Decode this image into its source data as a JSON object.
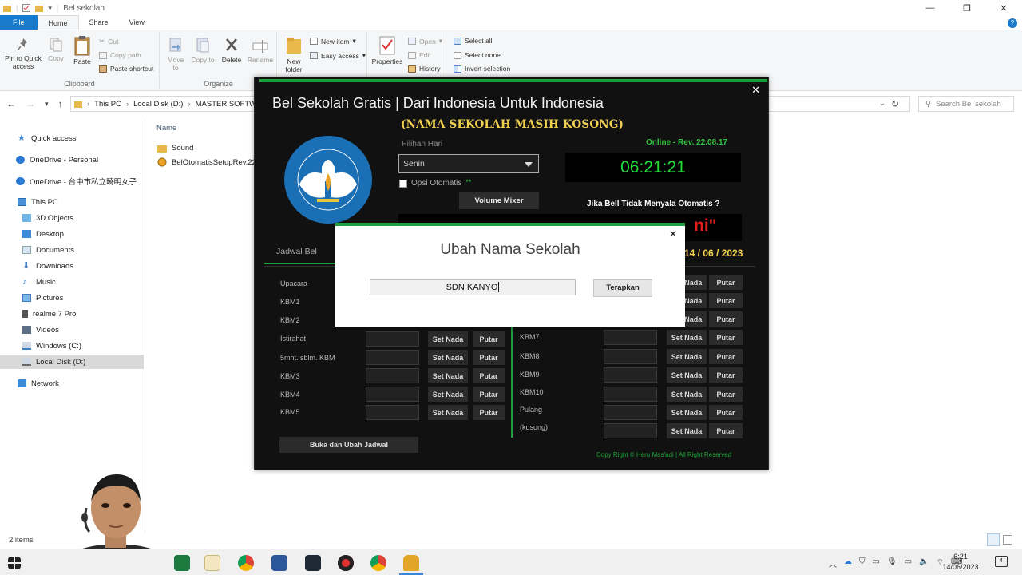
{
  "explorer": {
    "title": "Bel sekolah",
    "ribbon_tabs": [
      "File",
      "Home",
      "Share",
      "View"
    ],
    "clipboard": {
      "group_label": "Clipboard",
      "pin_label": "Pin to Quick access",
      "copy_label": "Copy",
      "paste_label": "Paste",
      "cut_label": "Cut",
      "copy_path_label": "Copy path",
      "paste_shortcut_label": "Paste shortcut"
    },
    "organize": {
      "group_label": "Organize",
      "move_to_label": "Move to",
      "copy_to_label": "Copy to",
      "delete_label": "Delete",
      "rename_label": "Rename"
    },
    "new": {
      "new_folder_label": "New folder",
      "new_item_label": "New item",
      "easy_access_label": "Easy access"
    },
    "open": {
      "properties_label": "Properties",
      "open_label": "Open",
      "edit_label": "Edit",
      "history_label": "History"
    },
    "select": {
      "select_all_label": "Select all",
      "select_none_label": "Select none",
      "invert_label": "Invert selection"
    },
    "address": {
      "crumbs": [
        "This PC",
        "Local Disk (D:)",
        "MASTER SOFTW"
      ],
      "search_placeholder": "Search Bel sekolah"
    },
    "nav_items": [
      {
        "label": "Quick access",
        "icon": "star-icon"
      },
      {
        "label": "OneDrive - Personal",
        "icon": "cloud-icon"
      },
      {
        "label": "OneDrive - 台中市私立曉明女子",
        "icon": "cloud-icon"
      },
      {
        "label": "This PC",
        "icon": "computer-icon"
      },
      {
        "label": "3D Objects",
        "icon": "cube-icon"
      },
      {
        "label": "Desktop",
        "icon": "desktop-icon"
      },
      {
        "label": "Documents",
        "icon": "document-icon"
      },
      {
        "label": "Downloads",
        "icon": "download-icon"
      },
      {
        "label": "Music",
        "icon": "music-icon"
      },
      {
        "label": "Pictures",
        "icon": "picture-icon"
      },
      {
        "label": "realme 7 Pro",
        "icon": "phone-icon"
      },
      {
        "label": "Videos",
        "icon": "video-icon"
      },
      {
        "label": "Windows (C:)",
        "icon": "drive-icon"
      },
      {
        "label": "Local Disk (D:)",
        "icon": "drive-icon"
      },
      {
        "label": "Network",
        "icon": "network-icon"
      }
    ],
    "column_name": "Name",
    "files": [
      {
        "name": "Sound",
        "icon": "folder-icon"
      },
      {
        "name": "BelOtomatisSetupRev.22",
        "icon": "installer-icon"
      }
    ],
    "status": "2 items"
  },
  "app": {
    "title": "Bel Sekolah Gratis | Dari Indonesia Untuk Indonesia",
    "school_name": "(NAMA SEKOLAH MASIH KOSONG)",
    "online_status": "Online - Rev. 22.08.17",
    "pilihan_label": "Pilihan Hari",
    "selected_day": "Senin",
    "clock": "06:21:21",
    "opsi_label": "Opsi Otomatis",
    "opsi_stars": "**",
    "volume_mixer_label": "Volume Mixer",
    "jika_text": "Jika Bell Tidak Menyala Otomatis ?",
    "marquee_text": "ni\"",
    "tab_label": "Jadwal Bel",
    "date": "14 / 06 / 2023",
    "set_nada_label": "Set Nada",
    "putar_label": "Putar",
    "left_schedule": [
      "Upacara",
      "KBM1",
      "KBM2",
      "Istirahat",
      "5mnt. sblm. KBM",
      "KBM3",
      "KBM4",
      "KBM5"
    ],
    "right_schedule": [
      "KBM7",
      "KBM8",
      "KBM9",
      "KBM10",
      "Pulang",
      "(kosong)"
    ],
    "buka_label": "Buka dan Ubah Jadwal",
    "copyright": "Copy Right © Heru Mas'adi | All Right Reserved",
    "accent_color": "#1d9f3b"
  },
  "dialog": {
    "title": "Ubah Nama Sekolah",
    "input_value": "SDN KANYO",
    "apply_label": "Terapkan"
  },
  "taskbar": {
    "time": "6:21",
    "date": "14/06/2023",
    "notification_count": "4"
  }
}
